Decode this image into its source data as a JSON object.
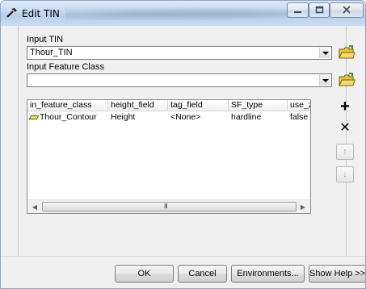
{
  "window": {
    "title": "Edit TIN"
  },
  "titlebar": {
    "min_glyph": "▭",
    "max_glyph": "▢",
    "close_glyph": "✕"
  },
  "form": {
    "input_tin_label": "Input TIN",
    "input_tin_value": "Thour_TIN",
    "input_fc_label": "Input Feature Class",
    "input_fc_value": ""
  },
  "table": {
    "columns": [
      "in_feature_class",
      "height_field",
      "tag_field",
      "SF_type",
      "use_z"
    ],
    "rows": [
      [
        "Thour_Contour",
        "Height",
        "<None>",
        "hardline",
        "false"
      ]
    ],
    "row_icons": [
      "polyline-feature-icon"
    ]
  },
  "scrollbar": {
    "grip": "III"
  },
  "side_buttons": {
    "add": "+",
    "remove": "✕",
    "up": "↑",
    "down": "↓"
  },
  "buttons": {
    "ok": "OK",
    "cancel": "Cancel",
    "environments": "Environments...",
    "show_help": "Show Help >>"
  },
  "colors": {
    "titlebar": "#c6daf0",
    "folder_yellow": "#e8c548",
    "folder_green": "#3a9a3a"
  }
}
